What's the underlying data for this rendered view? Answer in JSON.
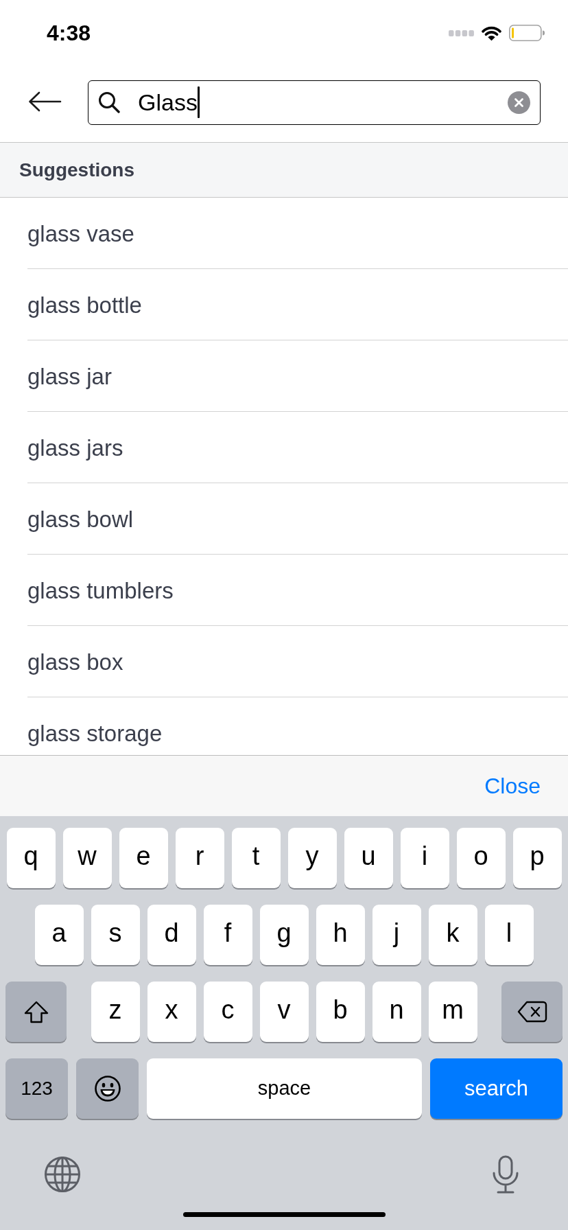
{
  "status_bar": {
    "time": "4:38"
  },
  "search": {
    "value": "Glass"
  },
  "suggestions": {
    "title": "Suggestions",
    "items": [
      "glass vase",
      "glass bottle",
      "glass jar",
      "glass jars",
      "glass bowl",
      "glass tumblers",
      "glass box",
      "glass storage"
    ]
  },
  "accessory_bar": {
    "close": "Close"
  },
  "keyboard": {
    "rows": [
      [
        {
          "kind": "letter",
          "label": "q"
        },
        {
          "kind": "letter",
          "label": "w"
        },
        {
          "kind": "letter",
          "label": "e"
        },
        {
          "kind": "letter",
          "label": "r"
        },
        {
          "kind": "letter",
          "label": "t"
        },
        {
          "kind": "letter",
          "label": "y"
        },
        {
          "kind": "letter",
          "label": "u"
        },
        {
          "kind": "letter",
          "label": "i"
        },
        {
          "kind": "letter",
          "label": "o"
        },
        {
          "kind": "letter",
          "label": "p"
        }
      ],
      [
        {
          "kind": "letter",
          "label": "a"
        },
        {
          "kind": "letter",
          "label": "s"
        },
        {
          "kind": "letter",
          "label": "d"
        },
        {
          "kind": "letter",
          "label": "f"
        },
        {
          "kind": "letter",
          "label": "g"
        },
        {
          "kind": "letter",
          "label": "h"
        },
        {
          "kind": "letter",
          "label": "j"
        },
        {
          "kind": "letter",
          "label": "k"
        },
        {
          "kind": "letter",
          "label": "l"
        }
      ],
      [
        {
          "kind": "shift"
        },
        {
          "kind": "letter",
          "label": "z"
        },
        {
          "kind": "letter",
          "label": "x"
        },
        {
          "kind": "letter",
          "label": "c"
        },
        {
          "kind": "letter",
          "label": "v"
        },
        {
          "kind": "letter",
          "label": "b"
        },
        {
          "kind": "letter",
          "label": "n"
        },
        {
          "kind": "letter",
          "label": "m"
        },
        {
          "kind": "backspace"
        }
      ]
    ],
    "bottom_bar": {
      "numbers_key": "123",
      "space_key": "space",
      "action_key": "search"
    }
  }
}
